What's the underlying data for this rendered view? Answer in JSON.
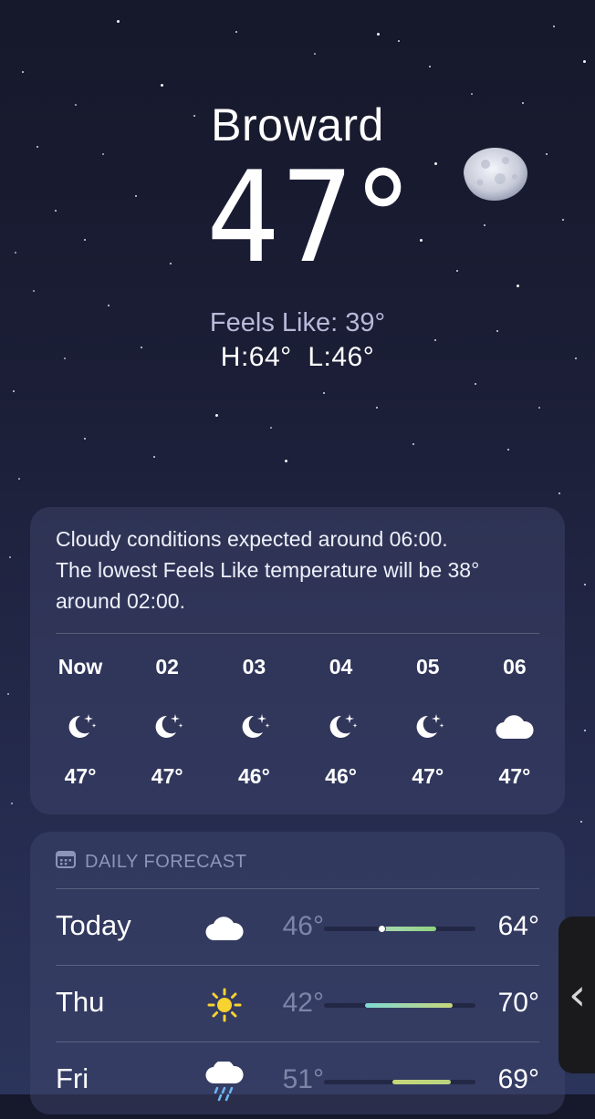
{
  "location": {
    "city": "Broward",
    "temperature": "47°",
    "feels_like": "Feels Like: 39°",
    "hi_lo": "H:64°  L:46°",
    "condition_icon": "moon-icon"
  },
  "hourly": {
    "summary_line1": "Cloudy conditions expected around 06:00.",
    "summary_line2": "The lowest Feels Like temperature will be 38°",
    "summary_line3": "around 02:00.",
    "items": [
      {
        "time": "Now",
        "icon": "moon-stars-icon",
        "temp": "47°"
      },
      {
        "time": "02",
        "icon": "moon-stars-icon",
        "temp": "47°"
      },
      {
        "time": "03",
        "icon": "moon-stars-icon",
        "temp": "46°"
      },
      {
        "time": "04",
        "icon": "moon-stars-icon",
        "temp": "46°"
      },
      {
        "time": "05",
        "icon": "moon-stars-icon",
        "temp": "47°"
      },
      {
        "time": "06",
        "icon": "cloud-icon",
        "temp": "47°"
      }
    ]
  },
  "daily": {
    "header": "DAILY FORECAST",
    "header_icon": "calendar-icon",
    "days": [
      {
        "day": "Today",
        "icon": "cloud-icon",
        "low": "46°",
        "high": "64°",
        "range_start_pct": 0.38,
        "range_end_pct": 0.74,
        "current_pct": 0.38,
        "fill": "linear-gradient(90deg,#a9d7b4,#8fd37e)"
      },
      {
        "day": "Thu",
        "icon": "sun-icon",
        "low": "42°",
        "high": "70°",
        "range_start_pct": 0.27,
        "range_end_pct": 0.85,
        "fill": "linear-gradient(90deg,#7fd8d4,#c7d67a)"
      },
      {
        "day": "Fri",
        "icon": "cloud-rain-icon",
        "low": "51°",
        "high": "69°",
        "range_start_pct": 0.45,
        "range_end_pct": 0.84,
        "fill": "linear-gradient(90deg,#c7d67a,#b9d57f)"
      }
    ]
  },
  "side_handle_icon": "chevron-left-icon"
}
